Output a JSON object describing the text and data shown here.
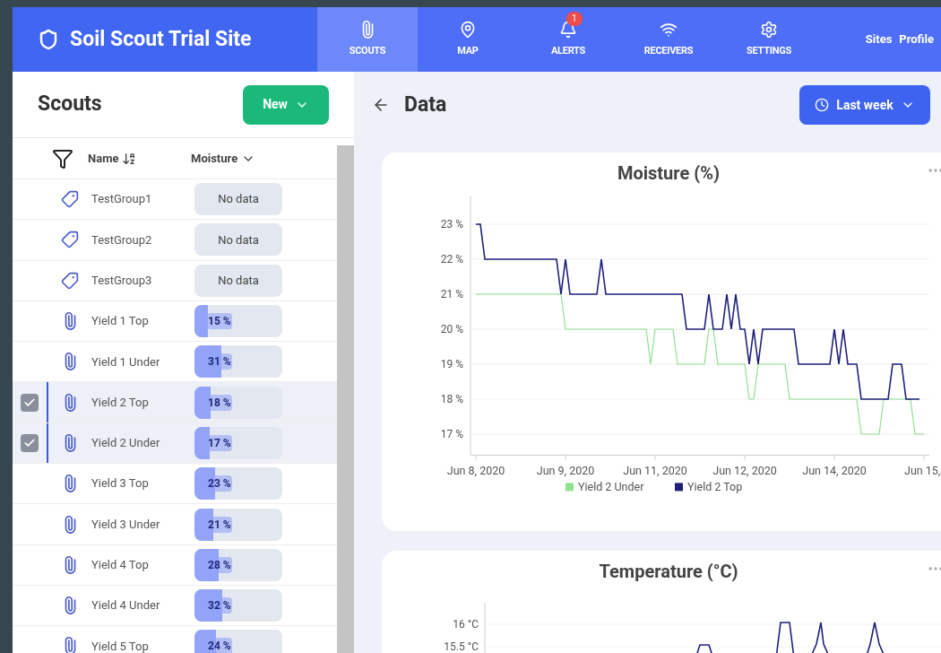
{
  "header": {
    "title": "Soil Scout Trial Site",
    "nav": [
      {
        "kind": "scouts",
        "label": "SCOUTS",
        "selected": true
      },
      {
        "kind": "map",
        "label": "MAP",
        "selected": false
      },
      {
        "kind": "alerts",
        "label": "ALERTS",
        "selected": false,
        "badge": "1"
      },
      {
        "kind": "receivers",
        "label": "RECEIVERS",
        "selected": false
      },
      {
        "kind": "settings",
        "label": "SETTINGS",
        "selected": false
      }
    ],
    "links": [
      "Sites",
      "Profile"
    ]
  },
  "sidebar": {
    "title": "Scouts",
    "new_button": "New",
    "columns": [
      "Name",
      "Moisture"
    ],
    "rows": [
      {
        "kind": "group",
        "name": "TestGroup1",
        "reading": "No data",
        "checked": false
      },
      {
        "kind": "group",
        "name": "TestGroup2",
        "reading": "No data",
        "checked": false
      },
      {
        "kind": "group",
        "name": "TestGroup3",
        "reading": "No data",
        "checked": false
      },
      {
        "kind": "scout",
        "name": "Yield 1 Top",
        "reading": "15 %",
        "level": 0.15,
        "checked": false
      },
      {
        "kind": "scout",
        "name": "Yield 1 Under",
        "reading": "31 %",
        "level": 0.31,
        "checked": false
      },
      {
        "kind": "scout",
        "name": "Yield 2 Top",
        "reading": "18 %",
        "level": 0.18,
        "checked": true
      },
      {
        "kind": "scout",
        "name": "Yield 2 Under",
        "reading": "17 %",
        "level": 0.17,
        "checked": true
      },
      {
        "kind": "scout",
        "name": "Yield 3 Top",
        "reading": "23 %",
        "level": 0.23,
        "checked": false
      },
      {
        "kind": "scout",
        "name": "Yield 3 Under",
        "reading": "21 %",
        "level": 0.21,
        "checked": false
      },
      {
        "kind": "scout",
        "name": "Yield 4 Top",
        "reading": "28 %",
        "level": 0.28,
        "checked": false
      },
      {
        "kind": "scout",
        "name": "Yield 4 Under",
        "reading": "32 %",
        "level": 0.32,
        "checked": false
      },
      {
        "kind": "scout",
        "name": "Yield 5 Top",
        "reading": "24 %",
        "level": 0.24,
        "checked": false
      }
    ]
  },
  "main": {
    "title": "Data",
    "range_button": "Last week",
    "moisture_chart": {
      "title": "Moisture (%)",
      "cut_x_label": "Jun 15,",
      "chart_data": {
        "type": "line",
        "grid": true,
        "legend": "bottom",
        "ylim": [
          16.4,
          23.8
        ],
        "categories": [
          "Jun 8, 2020",
          null,
          null,
          null,
          null,
          null,
          null,
          null,
          null,
          null,
          null,
          null,
          null,
          null,
          null,
          null,
          null,
          null,
          null,
          null,
          "Jun 9, 2020",
          null,
          null,
          null,
          null,
          null,
          null,
          null,
          null,
          null,
          null,
          null,
          null,
          null,
          null,
          null,
          null,
          null,
          null,
          null,
          "Jun 11, 2020",
          null,
          null,
          null,
          null,
          null,
          null,
          null,
          null,
          null,
          null,
          null,
          null,
          null,
          null,
          null,
          null,
          null,
          null,
          null,
          "Jun 12, 2020",
          null,
          null,
          null,
          null,
          null,
          null,
          null,
          null,
          null,
          null,
          null,
          null,
          null,
          null,
          null,
          null,
          null,
          null,
          null,
          "Jun 14, 2020",
          null,
          null,
          null,
          null,
          null,
          null,
          null,
          null,
          null,
          null,
          null,
          null,
          null,
          null,
          null,
          null,
          null,
          null,
          null,
          null
        ],
        "yticks": [
          {
            "value": 17,
            "label": "17 %"
          },
          {
            "value": 18,
            "label": "18 %"
          },
          {
            "value": 19,
            "label": "19 %"
          },
          {
            "value": 20,
            "label": "20 %"
          },
          {
            "value": 21,
            "label": "21 %"
          },
          {
            "value": 22,
            "label": "22 %"
          },
          {
            "value": 23,
            "label": "23 %"
          }
        ],
        "series": [
          {
            "name": "Yield 2 Under",
            "color": "#90e090",
            "values": [
              21,
              21,
              21,
              21,
              21,
              21,
              21,
              21,
              21,
              21,
              21,
              21,
              21,
              21,
              21,
              21,
              21,
              21,
              21,
              21,
              20,
              20,
              20,
              20,
              20,
              20,
              20,
              20,
              20,
              20,
              20,
              20,
              20,
              20,
              20,
              20,
              20,
              20,
              20,
              19,
              20,
              20,
              20,
              20,
              20,
              19,
              19,
              19,
              19,
              19,
              19,
              19,
              20,
              20,
              19,
              19,
              19,
              19,
              19,
              19,
              19,
              18,
              18,
              19,
              19,
              19,
              19,
              19,
              19,
              19,
              18,
              18,
              18,
              18,
              18,
              18,
              18,
              18,
              18,
              18,
              18,
              18,
              18,
              18,
              18,
              18,
              17,
              17,
              17,
              17,
              17,
              18,
              18,
              18,
              18,
              18,
              18,
              18,
              17,
              17,
              17
            ]
          },
          {
            "name": "Yield 2 Top",
            "color": "#1f1f7a",
            "values": [
              23,
              23,
              22,
              22,
              22,
              22,
              22,
              22,
              22,
              22,
              22,
              22,
              22,
              22,
              22,
              22,
              22,
              22,
              22,
              21,
              22,
              21,
              21,
              21,
              21,
              21,
              21,
              21,
              22,
              21,
              21,
              21,
              21,
              21,
              21,
              21,
              21,
              21,
              21,
              21,
              21,
              21,
              21,
              21,
              21,
              21,
              21,
              20,
              20,
              20,
              20,
              20,
              21,
              20,
              20,
              20,
              21,
              20,
              21,
              20,
              20,
              19,
              20,
              19,
              20,
              20,
              20,
              20,
              20,
              20,
              20,
              20,
              19,
              19,
              19,
              19,
              19,
              19,
              19,
              19,
              20,
              19,
              20,
              19,
              19,
              19,
              18,
              18,
              18,
              18,
              18,
              18,
              18,
              19,
              19,
              19,
              18,
              18,
              18,
              18,
              null
            ]
          }
        ]
      }
    },
    "temperature_chart": {
      "title": "Temperature (°C)",
      "y_labels": [
        "16 °C",
        "15.5 °C"
      ]
    }
  }
}
